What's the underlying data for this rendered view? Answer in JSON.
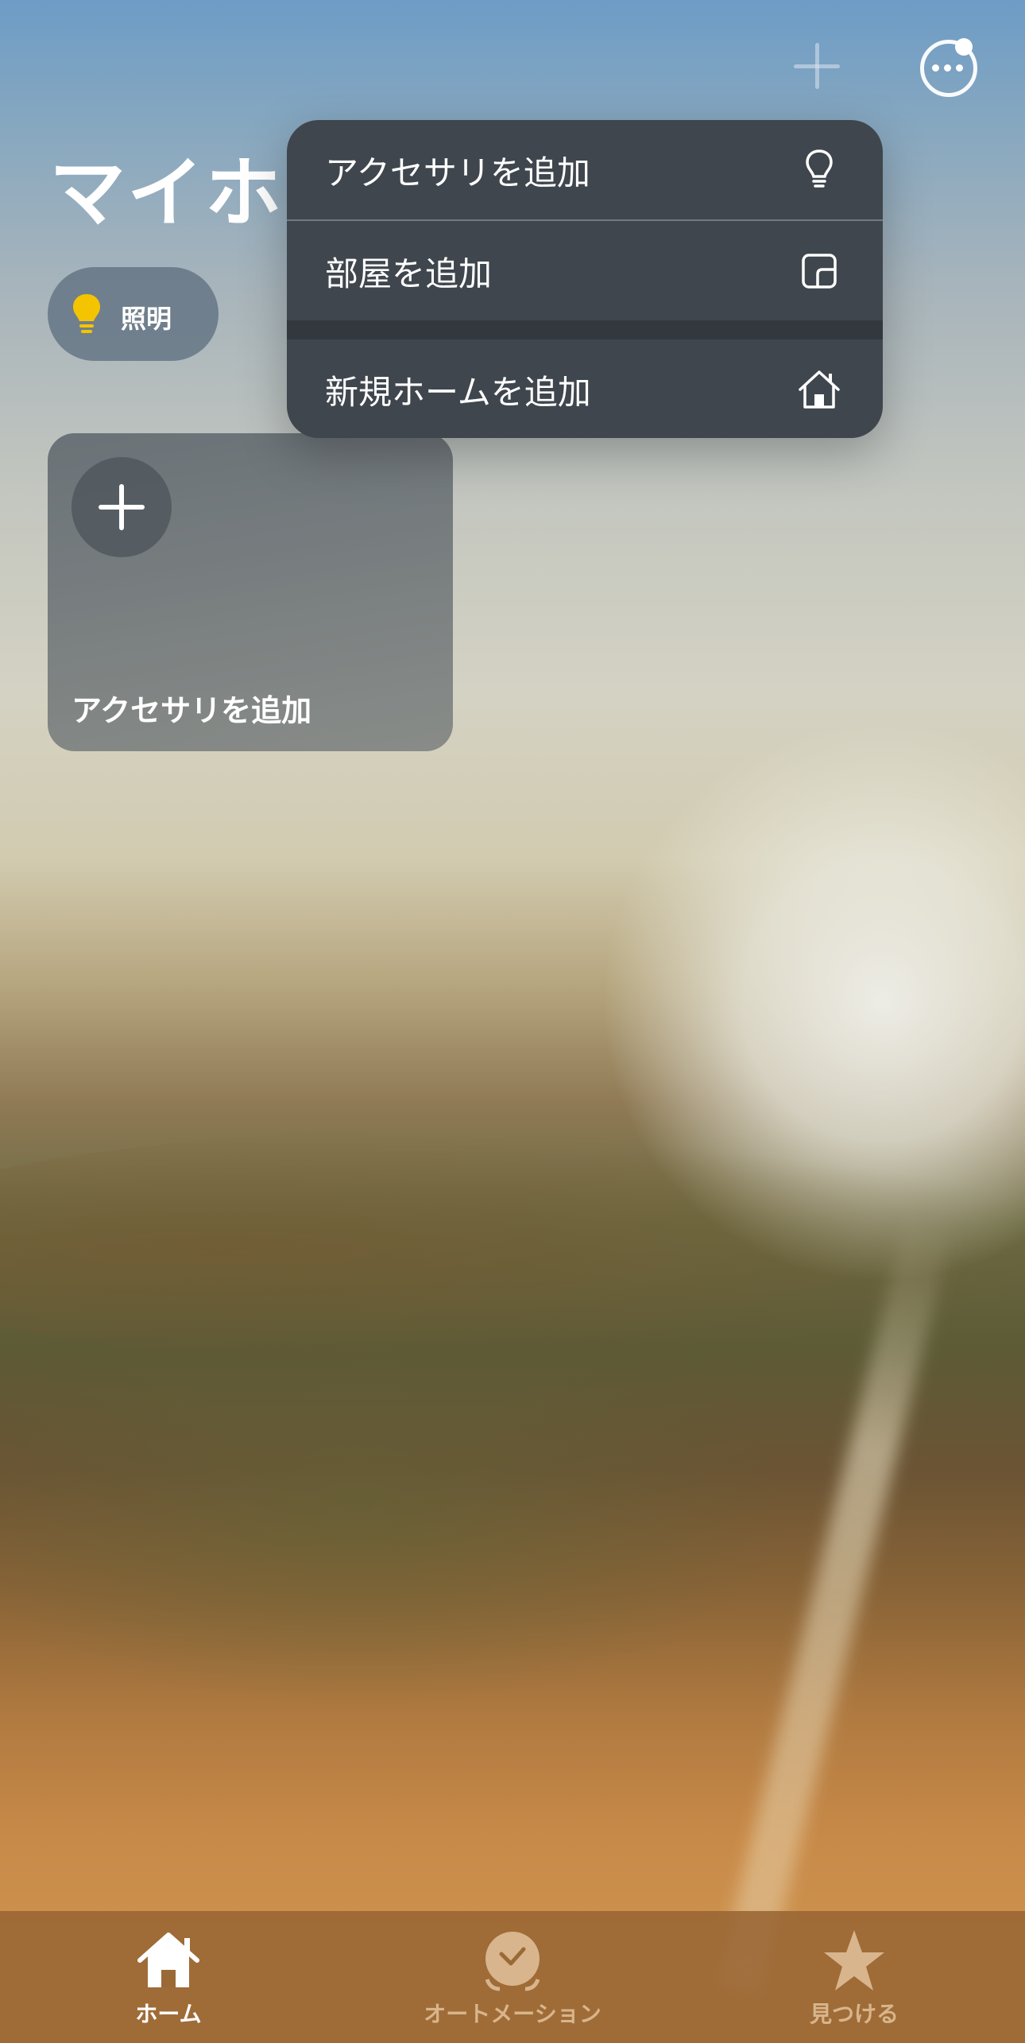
{
  "header": {
    "title": "マイホーム",
    "add_icon": "plus-icon",
    "more_icon": "ellipsis-circle-icon"
  },
  "chips": [
    {
      "label": "照明",
      "icon": "lightbulb-icon",
      "icon_color": "#f5c400"
    }
  ],
  "card": {
    "label": "アクセサリを追加",
    "icon": "plus-icon"
  },
  "menu": {
    "items": [
      {
        "label": "アクセサリを追加",
        "icon": "lightbulb-icon"
      },
      {
        "label": "部屋を追加",
        "icon": "room-icon"
      },
      {
        "label": "新規ホームを追加",
        "icon": "house-icon"
      }
    ]
  },
  "tabbar": {
    "tabs": [
      {
        "label": "ホーム",
        "icon": "house-icon",
        "selected": true,
        "color": "#ffffff"
      },
      {
        "label": "オートメーション",
        "icon": "clock-check-icon",
        "selected": false,
        "color": "#d8b58c"
      },
      {
        "label": "見つける",
        "icon": "star-icon",
        "selected": false,
        "color": "#d8b58c"
      }
    ]
  }
}
